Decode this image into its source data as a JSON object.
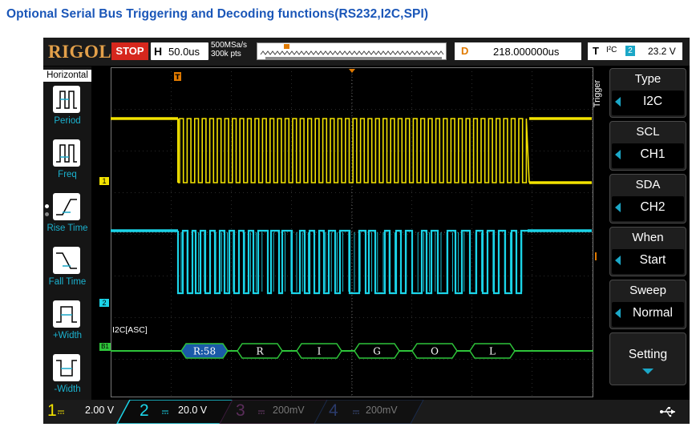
{
  "page_title": "Optional Serial Bus Triggering and Decoding functions(RS232,I2C,SPI)",
  "brand": "RIGOL",
  "run_state": "STOP",
  "horizontal": {
    "key": "H",
    "value": "50.0us"
  },
  "sample_rate": "500MSa/s",
  "mem_depth": "300k pts",
  "delay": {
    "key": "D",
    "value": "218.000000us"
  },
  "trigger_status": {
    "key": "T",
    "source": "I²C",
    "channel": "2",
    "level": "23.2 V"
  },
  "left_menu": {
    "title": "Horizontal",
    "items": [
      {
        "label": "Period",
        "icon": "period-icon"
      },
      {
        "label": "Freq",
        "icon": "frequency-icon"
      },
      {
        "label": "Rise Time",
        "icon": "rise-time-icon"
      },
      {
        "label": "Fall Time",
        "icon": "fall-time-icon"
      },
      {
        "label": "+Width",
        "icon": "positive-width-icon"
      },
      {
        "label": "-Width",
        "icon": "negative-width-icon"
      }
    ]
  },
  "right_menu": {
    "title": "Trigger",
    "items": [
      {
        "header": "Type",
        "value": "I2C"
      },
      {
        "header": "SCL",
        "value": "CH1"
      },
      {
        "header": "SDA",
        "value": "CH2"
      },
      {
        "header": "When",
        "value": "Start"
      },
      {
        "header": "Sweep",
        "value": "Normal"
      }
    ],
    "setting_label": "Setting"
  },
  "bus": {
    "label": "I2C[ASC]",
    "marker": "B1",
    "frames": [
      "R:58",
      "R",
      "I",
      "G",
      "O",
      "L"
    ]
  },
  "channel_markers": [
    "1",
    "2"
  ],
  "channels": [
    {
      "num": "1",
      "scale": "2.00 V",
      "color": "#f2e200"
    },
    {
      "num": "2",
      "scale": "20.0 V",
      "color": "#1bd4e8"
    },
    {
      "num": "3",
      "scale": "200mV",
      "color": "#c040c0"
    },
    {
      "num": "4",
      "scale": "200mV",
      "color": "#2060d0"
    }
  ],
  "colors": {
    "ch1": "#f2e200",
    "ch2": "#1bd4e8",
    "bus": "#2ec43a",
    "trigger": "#e07a00",
    "menu_accent": "#1bb2cf",
    "title": "#1a56b8"
  }
}
